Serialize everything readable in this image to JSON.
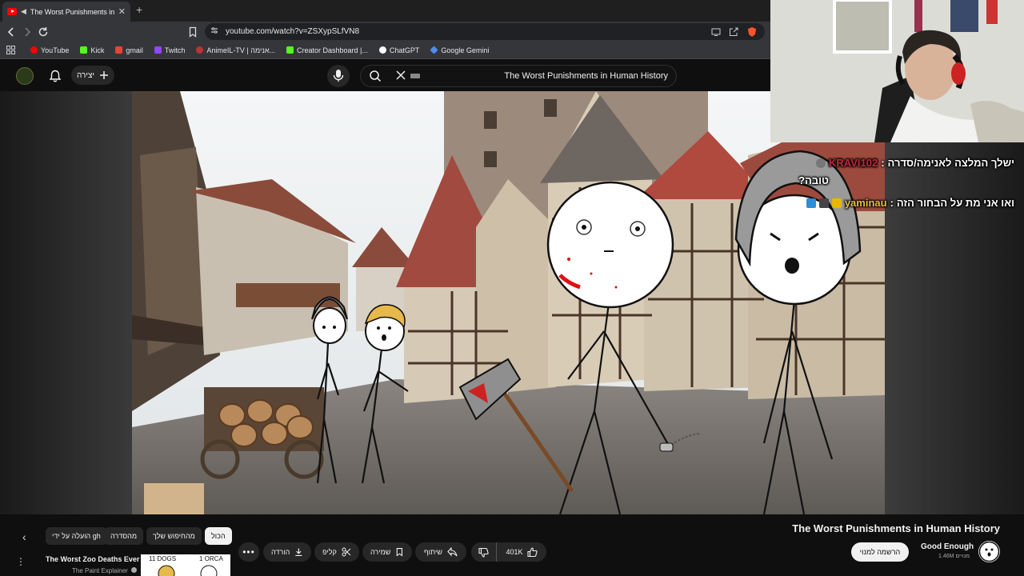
{
  "browser": {
    "tab_title": "The Worst Punishments in Hu",
    "url": "youtube.com/watch?v=ZSXypSLfVN8",
    "bookmarks": [
      {
        "label": "YouTube",
        "color": "#ff0000"
      },
      {
        "label": "Kick",
        "color": "#53fc18"
      },
      {
        "label": "gmail",
        "color": "#ea4335"
      },
      {
        "label": "Twitch",
        "color": "#9146ff"
      },
      {
        "label": "AnimeIL-TV | אנימה...",
        "color": "#b33"
      },
      {
        "label": "Creator Dashboard |...",
        "color": "#53fc18"
      },
      {
        "label": "ChatGPT",
        "color": "#ffffff"
      },
      {
        "label": "Google Gemini",
        "color": "#4f8cff"
      }
    ]
  },
  "youtube": {
    "create_label": "יצירה",
    "search_text": "The Worst Punishments in Human History"
  },
  "chat": {
    "messages": [
      {
        "user": "KRAVI102",
        "text": "ישלך המלצה לאנימה/סדרה",
        "continuation": "טובה?",
        "user_color": "#c0283c"
      },
      {
        "user": "yaminau",
        "text": "ואו אני מת על הבחור הזה",
        "user_color": "#e6c23a"
      }
    ]
  },
  "video": {
    "title": "The Worst Punishments in Human History",
    "channel": "Good Enough",
    "subscribers": "1.46M מנויים",
    "subscribe_label": "הרשמה למנוי",
    "likes": "401K",
    "share_label": "שיתוף",
    "save_label": "שמירה",
    "clip_label": "קליפ",
    "download_label": "הורדה"
  },
  "chips": [
    {
      "label": "הכול",
      "active": true
    },
    {
      "label": "מהחיפוש שלך",
      "active": false
    },
    {
      "label": "מהסדרה",
      "active": false
    },
    {
      "label": "הועלה על ידי gh",
      "active": false
    }
  ],
  "recommendation": {
    "title": "The Worst Zoo Deaths Ever",
    "channel": "The Paint Explainer",
    "thumb_text_left": "11 DOGS",
    "thumb_text_right": "1 ORCA"
  }
}
